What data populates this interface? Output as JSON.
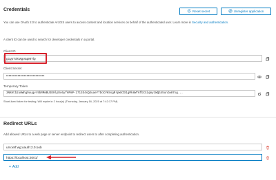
{
  "credentials": {
    "title": "Credentials",
    "reset_secret_label": "Reset secret",
    "unregister_label": "Unregister application",
    "description": "You can use OAuth 2.0 to authenticate ArcGIS users to access content and location services on behalf of the authenticated user. Learn more in",
    "description_link": "Security and authentication.",
    "client_id_info": "A client ID can be used to search for developer credentials in a portal.",
    "client_id_label": "Client ID",
    "client_id_value": "g1ypTxkMgVapMTlp",
    "client_secret_label": "Client Secret",
    "client_secret_value": "••••••••••••••••••••••••••••••",
    "temp_token_label": "Temporary Token",
    "temp_token_value": "3NKHtb2umWhgOuugvr9bRMmBU3D0lpDo6yfHPmP-1713E4sQXuaeYTDoCVHSsgRrpWVZX1gMk8WT6fbCXiqmyzWQG45unIw87xg...",
    "token_note": "Short-lived token for testing. Will expire in 2 hour(s) (Thursday, January 16, 2025 at 7:42:17 PM)."
  },
  "redirect": {
    "title": "Redirect URLs",
    "description": "Add allowed URLs to a web page or server endpoint to redirect users to after completing authentication.",
    "urls": [
      "urn:ietf:wg:oauth:2.0:oob",
      "https://localhost:3001/"
    ],
    "add_label": "Add"
  },
  "colors": {
    "accent": "#007ac2",
    "highlight": "#d6212b",
    "danger": "#d83020"
  },
  "icons": [
    "reset-icon",
    "unregister-icon",
    "copy-icon",
    "eye-icon",
    "refresh-icon",
    "delete-icon",
    "plus-icon",
    "arrow-icon"
  ]
}
